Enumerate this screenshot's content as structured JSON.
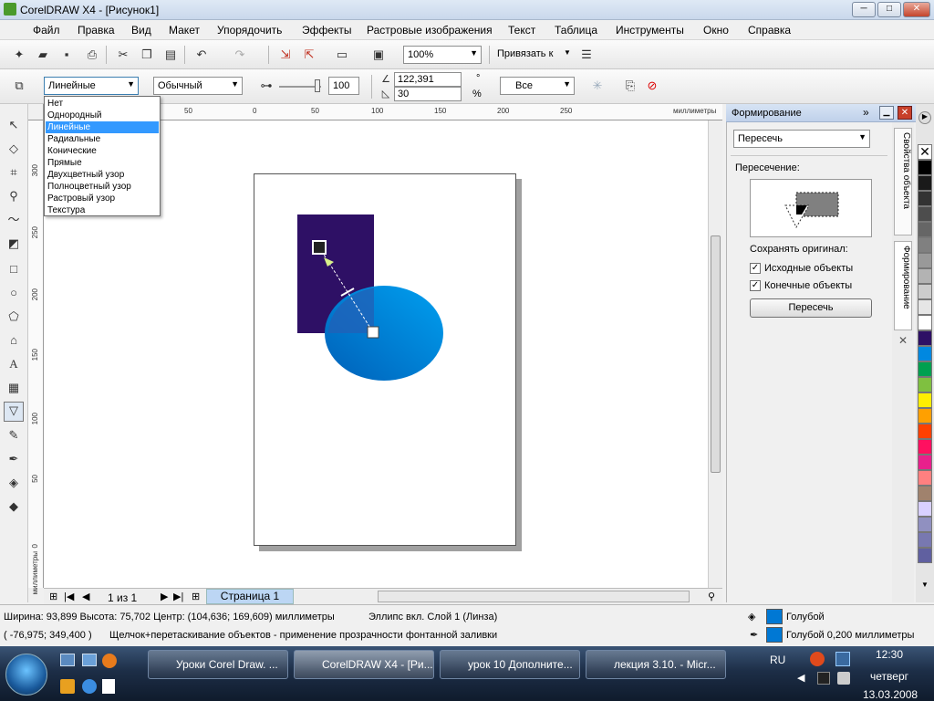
{
  "window": {
    "title": "CorelDRAW X4 - [Рисунок1]",
    "minimize": "─",
    "maximize": "□",
    "close": "✕"
  },
  "menu": [
    "Файл",
    "Правка",
    "Вид",
    "Макет",
    "Упорядочить",
    "Эффекты",
    "Растровые изображения",
    "Текст",
    "Таблица",
    "Инструменты",
    "Окно",
    "Справка"
  ],
  "toolbar": {
    "zoom": "100%",
    "snap": "Привязать к"
  },
  "property_bar": {
    "fill_type": "Линейные",
    "blend_mode": "Обычный",
    "transparency": "100",
    "angle": "122,391",
    "edge": "30",
    "degree_unit": "°",
    "percent_unit": "%",
    "apply_to": "Все"
  },
  "fill_type_options": [
    "Нет",
    "Однородный",
    "Линейные",
    "Радиальные",
    "Конические",
    "Прямые",
    "Двухцветный узор",
    "Полноцветный узор",
    "Растровый узор",
    "Текстура"
  ],
  "ruler": {
    "top_labels": [
      "50",
      "0",
      "50",
      "100",
      "150",
      "200",
      "250"
    ],
    "top_unit": "миллиметры",
    "left_labels": [
      "300",
      "250",
      "200",
      "150",
      "100",
      "50",
      "0"
    ],
    "left_unit": "миллиметры"
  },
  "page_nav": {
    "counter": "1 из 1",
    "tab": "Страница 1"
  },
  "docker": {
    "title": "Формирование",
    "operation": "Пересечь",
    "intersection_label": "Пересечение:",
    "keep_original": "Сохранять оригинал:",
    "source_objects": "Исходные объекты",
    "target_objects": "Конечные объекты",
    "apply_button": "Пересечь",
    "tab_properties": "Свойства объекта",
    "tab_shaping": "Формирование",
    "close": "✕"
  },
  "palette_colors": [
    "#ffffff",
    "#000000",
    "#1a1a1a",
    "#333333",
    "#4d4d4d",
    "#666666",
    "#808080",
    "#999999",
    "#b3b3b3",
    "#cccccc",
    "#e6e6e6",
    "#ffffff",
    "#2e1065",
    "#0088e0",
    "#00a0e8",
    "#00a050",
    "#7fc040",
    "#ffee00",
    "#ffa000",
    "#ff4000",
    "#ff1060",
    "#e8208c",
    "#ff8080",
    "#ff6060",
    "#a0826d",
    "#d8d0ff",
    "#9090c0",
    "#7878b0",
    "#6060a0"
  ],
  "status": {
    "dims": "Ширина: 93,899  Высота: 75,702  Центр: (104,636; 169,609)  миллиметры",
    "object": "Эллипс вкл. Слой 1  (Линза)",
    "coords": "( -76,975; 349,400 )",
    "hint": "Щелчок+перетаскивание объектов - применение прозрачности фонтанной заливки",
    "fill_name": "Голубой",
    "outline_name": "Голубой  0,200 миллиметры",
    "fill_color": "#0078d4",
    "outline_color": "#0078d4"
  },
  "taskbar": {
    "tasks": [
      "Уроки Corel Draw. ...",
      "CorelDRAW X4 - [Ри...",
      "урок 10 Дополните...",
      "лекция 3.10. - Micr..."
    ],
    "lang": "RU",
    "time": "12:30",
    "day": "четверг",
    "date": "13.03.2008"
  }
}
